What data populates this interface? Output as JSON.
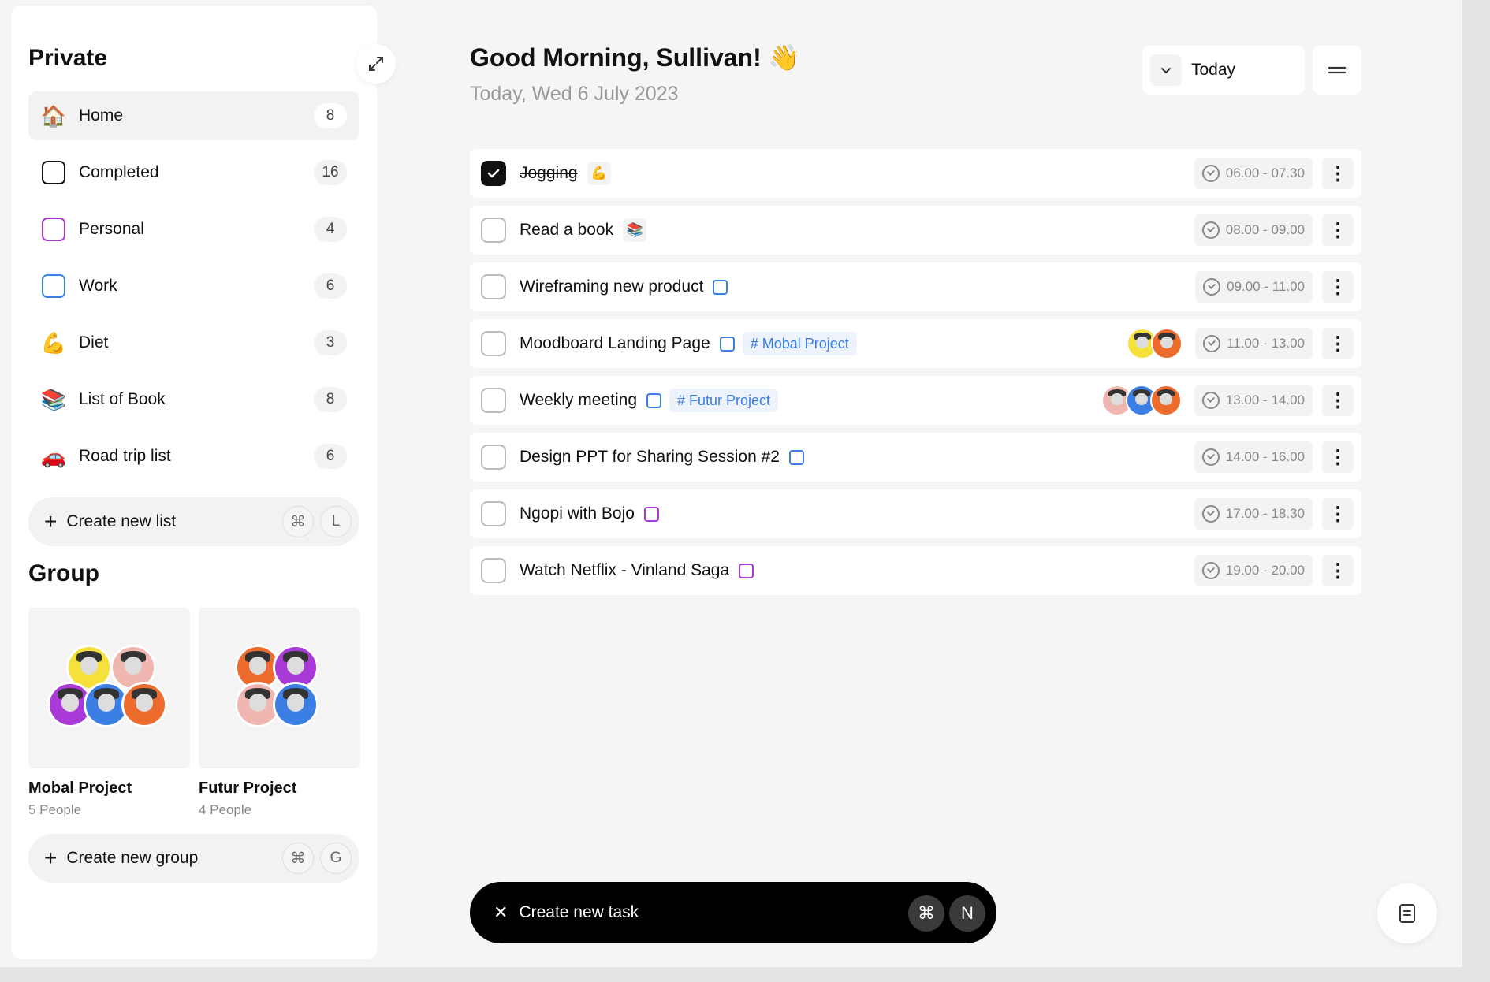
{
  "sidebar": {
    "private_title": "Private",
    "lists": [
      {
        "label": "Home",
        "count": "8",
        "icon": "🏠"
      },
      {
        "label": "Completed",
        "count": "16",
        "color": "#111111"
      },
      {
        "label": "Personal",
        "count": "4",
        "color": "#a93ad8"
      },
      {
        "label": "Work",
        "count": "6",
        "color": "#3b7ee4"
      },
      {
        "label": "Diet",
        "count": "3",
        "icon": "💪"
      },
      {
        "label": "List of Book",
        "count": "8",
        "icon": "📚"
      },
      {
        "label": "Road trip list",
        "count": "6",
        "icon": "🚗"
      }
    ],
    "create_list": {
      "label": "Create new list",
      "key1": "⌘",
      "key2": "L"
    },
    "group_title": "Group",
    "groups": [
      {
        "name": "Mobal Project",
        "people": "5 People"
      },
      {
        "name": "Futur Project",
        "people": "4 People"
      }
    ],
    "create_group": {
      "label": "Create new group",
      "key1": "⌘",
      "key2": "G"
    }
  },
  "header": {
    "greeting": "Good Morning, Sullivan! 👋",
    "date": "Today, Wed 6 July 2023",
    "filter_label": "Today"
  },
  "tasks": [
    {
      "title": "Jogging",
      "done": true,
      "emoji": "💪",
      "time": "06.00 - 07.30"
    },
    {
      "title": "Read a book",
      "emoji": "📚",
      "time": "08.00 - 09.00"
    },
    {
      "title": "Wireframing new product",
      "tag_color": "#3b7ee4",
      "time": "09.00 - 11.00"
    },
    {
      "title": "Moodboard Landing Page",
      "tag_color": "#3b7ee4",
      "project": "# Mobal Project",
      "time": "11.00 - 13.00"
    },
    {
      "title": "Weekly meeting",
      "tag_color": "#3b7ee4",
      "project": "# Futur Project",
      "time": "13.00 - 14.00"
    },
    {
      "title": "Design PPT for Sharing Session #2",
      "tag_color": "#3b7ee4",
      "time": "14.00 - 16.00"
    },
    {
      "title": "Ngopi with Bojo",
      "tag_color": "#a93ad8",
      "time": "17.00 - 18.30"
    },
    {
      "title": "Watch Netflix - Vinland Saga",
      "tag_color": "#a93ad8",
      "time": "19.00 - 20.00"
    }
  ],
  "task_bar": {
    "label": "Create new task",
    "key1": "⌘",
    "key2": "N"
  },
  "colors": {
    "blue": "#3b7ee4",
    "purple": "#a93ad8",
    "yellow": "#f5e13a",
    "orange": "#ec6b2d",
    "pink": "#f0b7b0"
  },
  "icons": {
    "expand": "expand-icon",
    "chevron": "chevron-down-icon",
    "menu": "menu-icon",
    "more": "more-vertical-icon",
    "clock": "clock-icon",
    "note": "note-icon"
  }
}
